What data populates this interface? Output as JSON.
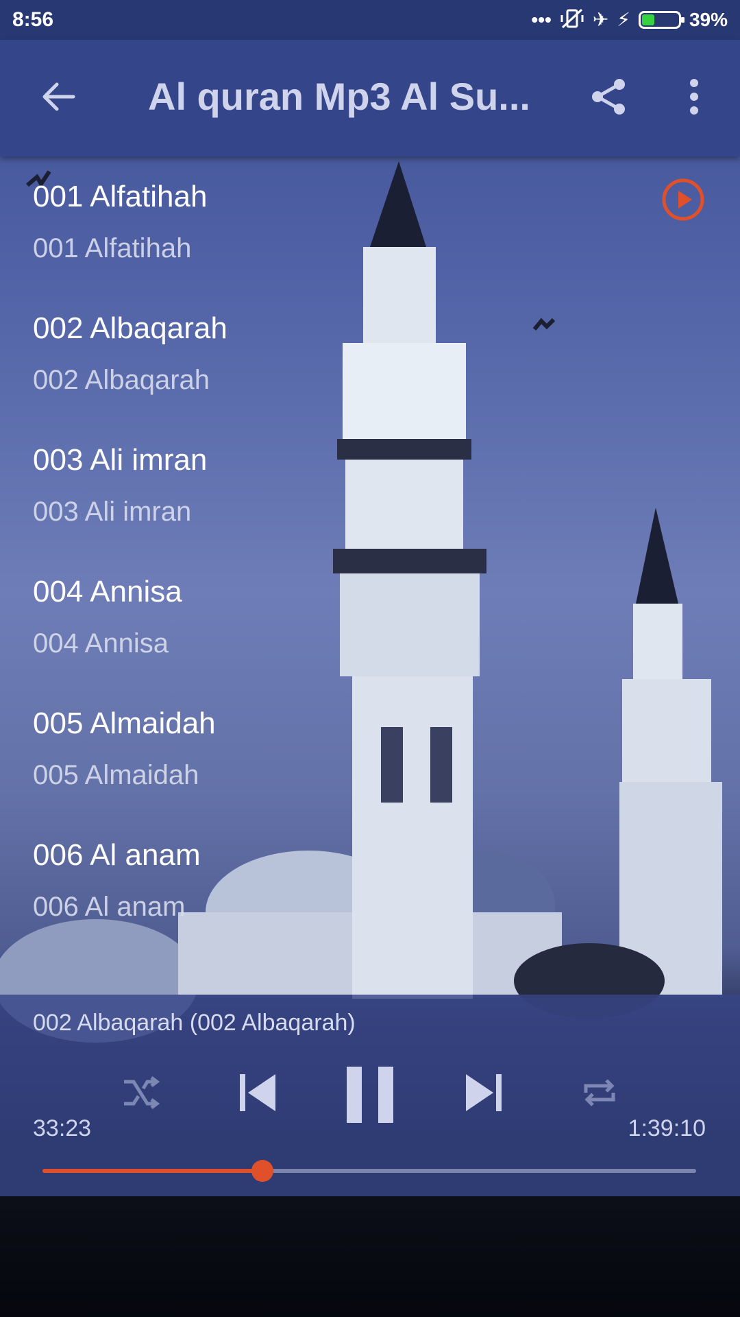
{
  "status_bar": {
    "time": "8:56",
    "battery_text": "39%",
    "battery_level": 0.39,
    "icons": [
      "more-dots-icon",
      "vibrate-off-icon",
      "airplane-icon",
      "charging-bolt-icon",
      "battery-icon"
    ]
  },
  "toolbar": {
    "title": "Al quran Mp3 Al Su...",
    "back_icon": "arrow-left-icon",
    "share_icon": "share-icon",
    "menu_icon": "more-vert-icon"
  },
  "tracks": [
    {
      "title": "001 Alfatihah",
      "subtitle": "001 Alfatihah"
    },
    {
      "title": "002 Albaqarah",
      "subtitle": "002 Albaqarah",
      "playing": true
    },
    {
      "title": "003 Ali imran",
      "subtitle": "003 Ali imran"
    },
    {
      "title": "004 Annisa",
      "subtitle": "004 Annisa"
    },
    {
      "title": "005 Almaidah",
      "subtitle": "005 Almaidah"
    },
    {
      "title": "006 Al anam",
      "subtitle": "006 Al anam"
    }
  ],
  "player": {
    "now_playing": "002 Albaqarah (002 Albaqarah)",
    "current_time": "33:23",
    "total_time": "1:39:10",
    "progress": 0.336,
    "controls": [
      "shuffle-icon",
      "previous-icon",
      "pause-icon",
      "next-icon",
      "repeat-icon"
    ]
  },
  "colors": {
    "accent": "#e0502a",
    "toolbar": "#34458a",
    "status_bar": "#283872",
    "battery_fill": "#37d23f"
  }
}
